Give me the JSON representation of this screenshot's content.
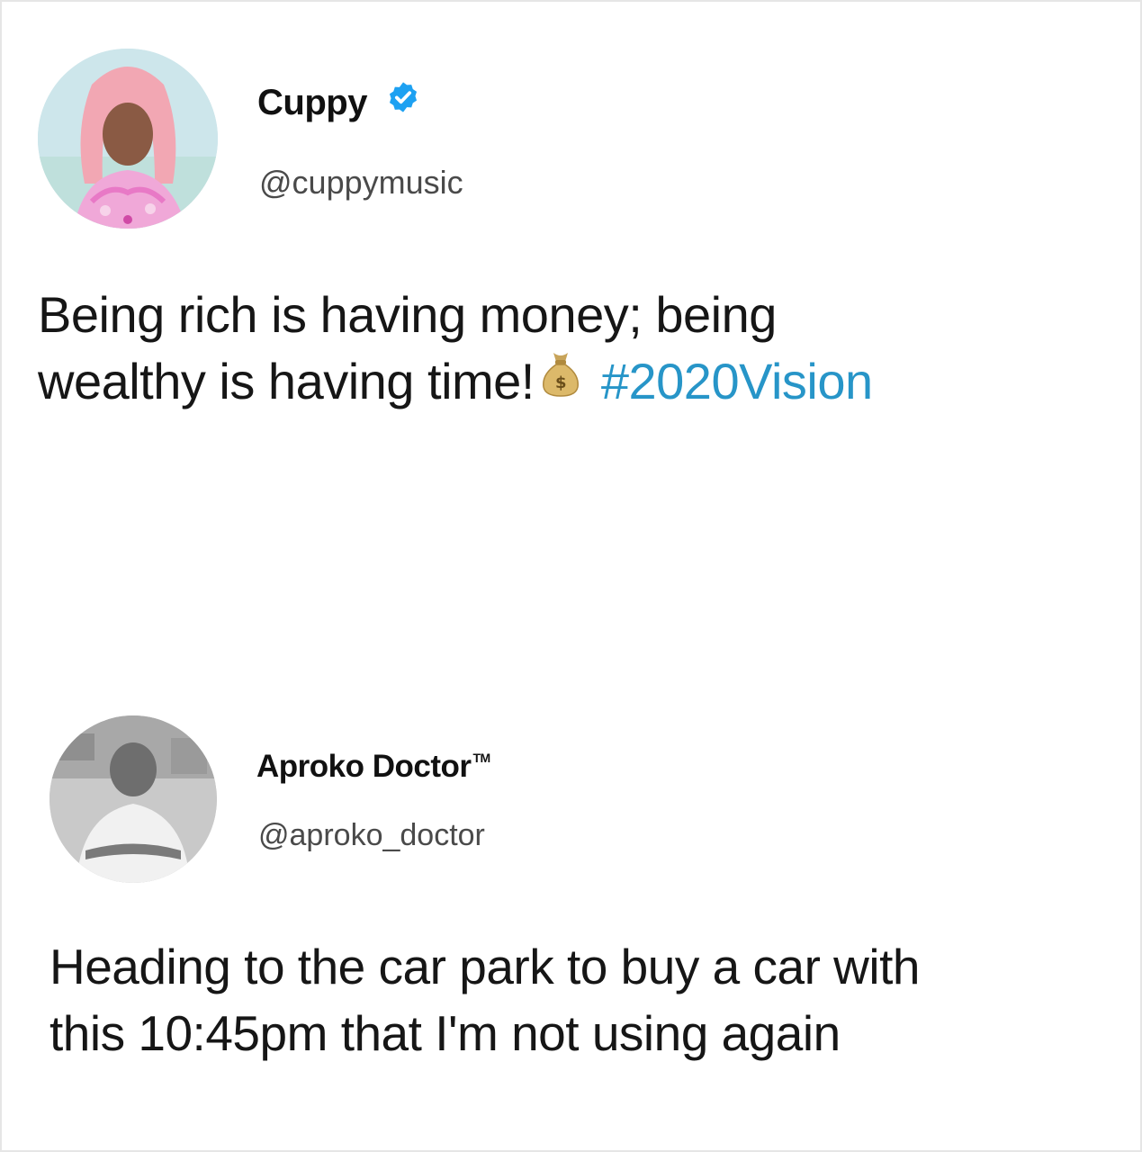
{
  "tweets": [
    {
      "display_name": "Cuppy",
      "verified": true,
      "handle": "@cuppymusic",
      "avatar_icon": "profile-photo-pink-hair",
      "text_line1": "Being rich is having money; being",
      "text_line2": "wealthy is having time!",
      "emoji_icon": "money-bag-icon",
      "hashtag": "#2020Vision"
    },
    {
      "display_name": "Aproko Doctor",
      "trademark": "TM",
      "handle": "@aproko_doctor",
      "avatar_icon": "profile-photo-grayscale",
      "text_line1": "Heading to the car park to buy a car with",
      "text_line2": "this 10:45pm that I'm not using again"
    }
  ],
  "colors": {
    "hashtag": "#2795c8",
    "verified_badge": "#1da1f2",
    "text": "#161616",
    "handle": "#4a4a4a"
  }
}
